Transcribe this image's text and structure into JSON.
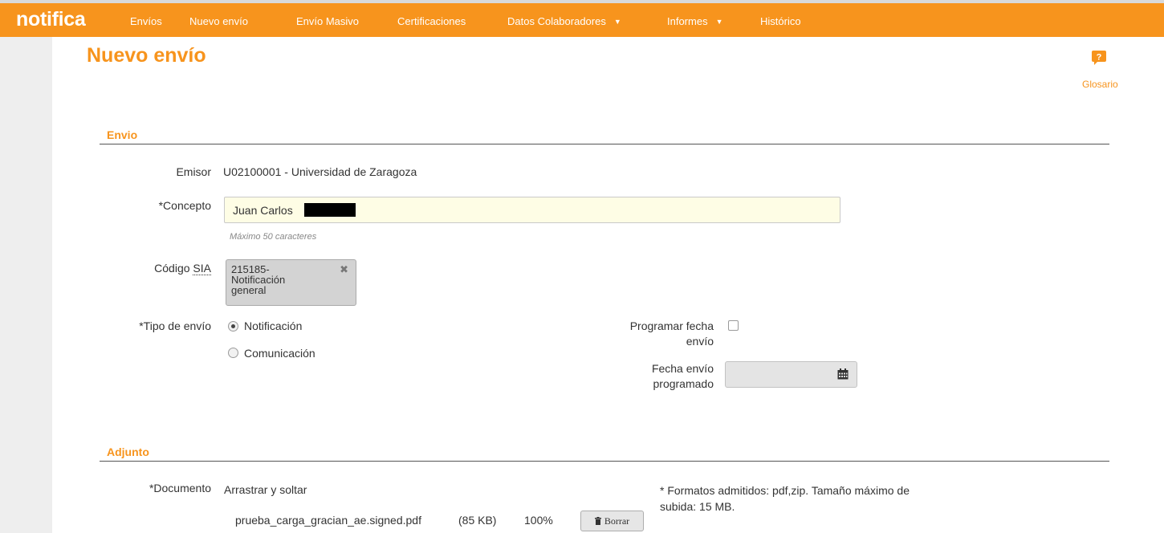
{
  "app": {
    "brand": "notifica"
  },
  "nav": {
    "items": [
      {
        "label": "Envíos"
      },
      {
        "label": "Nuevo envío"
      },
      {
        "label": "Envío Masivo"
      },
      {
        "label": "Certificaciones"
      },
      {
        "label": "Datos Colaboradores",
        "dropdown": true
      },
      {
        "label": "Informes",
        "dropdown": true
      },
      {
        "label": "Histórico"
      }
    ],
    "caret": "▼"
  },
  "page": {
    "title": "Nuevo envío"
  },
  "glosario": {
    "label": "Glosario",
    "icon": "question-icon",
    "glyph": "?"
  },
  "envio": {
    "section_title": "Envio",
    "emisor_label": "Emisor",
    "emisor_value": "U02100001 - Universidad de Zaragoza",
    "concepto_label": "*Concepto",
    "concepto_value": "Juan Carlos",
    "concepto_hint": "Máximo 50 caracteres",
    "sia_label_prefix": "Código ",
    "sia_label_abbr": "SIA",
    "sia_value": "215185-Notificación general",
    "sia_remove": "✖",
    "tipo_label": "*Tipo de envío",
    "tipo_options": [
      {
        "label": "Notificación",
        "selected": true
      },
      {
        "label": "Comunicación",
        "selected": false
      }
    ],
    "programar_label_line1": "Programar fecha",
    "programar_label_line2": "envío",
    "programar_checked": false,
    "fecha_label_line1": "Fecha envío",
    "fecha_label_line2": "programado",
    "fecha_value": ""
  },
  "adjunto": {
    "section_title": "Adjunto",
    "documento_label": "*Documento",
    "drop_text": "Arrastrar y soltar",
    "formats_line1": "* Formatos admitidos: pdf,zip. Tamaño máximo de",
    "formats_line2": "subida: 15 MB.",
    "file": {
      "name": "prueba_carga_gracian_ae.signed.pdf",
      "size": "(85 KB)",
      "progress": "100%"
    },
    "delete_label": "Borrar",
    "delete_icon": "trash-icon"
  },
  "colors": {
    "accent": "#f7941d",
    "leftbar": "#eeeeee",
    "input_bg": "#fefde5"
  }
}
